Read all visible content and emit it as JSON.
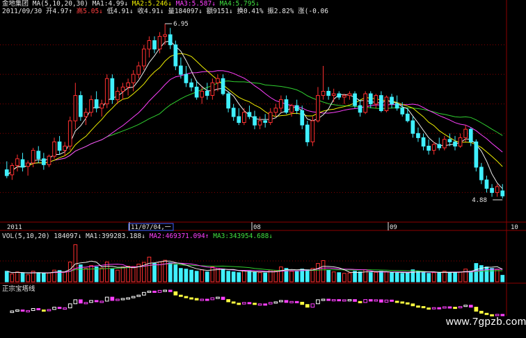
{
  "header": {
    "stock_name": "金地集团",
    "ma_label": "MA(5,10,20,30)",
    "ma1": "MA1:4.99↓",
    "ma2": "MA2:5.246↓",
    "ma3": "MA3:5.587↓",
    "ma4": "MA4:5.795↓",
    "date": "2011/09/30",
    "open": "开4.97↑",
    "high": "高5.05↓",
    "low": "低4.91↓",
    "close": "收4.91↓",
    "volume": "量184097↓",
    "amount": "额9151↓",
    "turnover": "换0.41%",
    "amplitude": "振2.82%",
    "change": "涨(-0.06"
  },
  "price_axis_labels": {
    "max_label": "6.95",
    "min_label": "4.88"
  },
  "x_axis": {
    "labels": [
      "2011",
      "11/07/04,一",
      "08",
      "09",
      "10"
    ]
  },
  "vol_header": {
    "label": "VOL(5,10,20)",
    "value": "184097↓",
    "ma1": "MA1:399283.188↓",
    "ma2": "MA2:469371.094↑",
    "ma3": "MA3:343954.688↓"
  },
  "indicator": {
    "label": "正宗宝塔线"
  },
  "watermark": "www.7gpzb.com",
  "colors": {
    "up": "#ff3030",
    "down": "#40f0ff",
    "ma5": "#f0f0f0",
    "ma10": "#f0f000",
    "ma20": "#ff40ff",
    "ma30": "#30d030",
    "grid": "#8b0000",
    "tower_up": "#ffffff",
    "tower_down": "#ffff40",
    "tower_switch": "#ff40ff"
  },
  "chart_data": {
    "type": "candlestick",
    "ylim": [
      4.6,
      7.05
    ],
    "candles": [
      [
        5.22,
        5.32,
        5.12,
        5.15
      ],
      [
        5.16,
        5.3,
        5.1,
        5.27
      ],
      [
        5.27,
        5.4,
        5.2,
        5.35
      ],
      [
        5.34,
        5.42,
        5.2,
        5.25
      ],
      [
        5.26,
        5.33,
        5.15,
        5.3
      ],
      [
        5.3,
        5.48,
        5.25,
        5.45
      ],
      [
        5.44,
        5.5,
        5.3,
        5.35
      ],
      [
        5.35,
        5.42,
        5.22,
        5.28
      ],
      [
        5.28,
        5.4,
        5.25,
        5.38
      ],
      [
        5.38,
        5.6,
        5.35,
        5.55
      ],
      [
        5.55,
        5.62,
        5.4,
        5.45
      ],
      [
        5.45,
        5.55,
        5.38,
        5.5
      ],
      [
        5.5,
        5.85,
        5.45,
        5.8
      ],
      [
        5.8,
        6.25,
        5.7,
        6.1
      ],
      [
        6.1,
        6.15,
        5.8,
        5.85
      ],
      [
        5.85,
        5.95,
        5.75,
        5.9
      ],
      [
        5.9,
        6.1,
        5.85,
        6.05
      ],
      [
        6.05,
        6.15,
        5.9,
        5.95
      ],
      [
        5.95,
        6.05,
        5.85,
        6.0
      ],
      [
        6.0,
        6.35,
        5.95,
        6.3
      ],
      [
        6.3,
        6.35,
        6.0,
        6.05
      ],
      [
        6.05,
        6.2,
        6.0,
        6.15
      ],
      [
        6.15,
        6.25,
        6.05,
        6.2
      ],
      [
        6.2,
        6.3,
        6.1,
        6.25
      ],
      [
        6.25,
        6.4,
        6.15,
        6.35
      ],
      [
        6.35,
        6.5,
        6.3,
        6.45
      ],
      [
        6.45,
        6.7,
        6.4,
        6.65
      ],
      [
        6.65,
        6.8,
        6.55,
        6.75
      ],
      [
        6.75,
        6.8,
        6.6,
        6.65
      ],
      [
        6.65,
        6.85,
        6.6,
        6.8
      ],
      [
        6.8,
        6.95,
        6.7,
        6.82
      ],
      [
        6.82,
        6.9,
        6.65,
        6.7
      ],
      [
        6.7,
        6.75,
        6.4,
        6.45
      ],
      [
        6.45,
        6.55,
        6.3,
        6.35
      ],
      [
        6.35,
        6.45,
        6.2,
        6.25
      ],
      [
        6.25,
        6.3,
        6.15,
        6.2
      ],
      [
        6.2,
        6.28,
        6.05,
        6.08
      ],
      [
        6.08,
        6.2,
        6.0,
        6.15
      ],
      [
        6.15,
        6.25,
        6.05,
        6.1
      ],
      [
        6.1,
        6.3,
        6.05,
        6.25
      ],
      [
        6.25,
        6.35,
        6.15,
        6.3
      ],
      [
        6.3,
        6.35,
        6.1,
        6.12
      ],
      [
        6.12,
        6.15,
        5.9,
        5.95
      ],
      [
        5.95,
        6.0,
        5.8,
        5.85
      ],
      [
        5.85,
        5.95,
        5.75,
        5.78
      ],
      [
        5.78,
        5.95,
        5.75,
        5.9
      ],
      [
        5.9,
        5.98,
        5.82,
        5.85
      ],
      [
        5.85,
        5.92,
        5.7,
        5.75
      ],
      [
        5.75,
        5.85,
        5.7,
        5.8
      ],
      [
        5.8,
        5.88,
        5.72,
        5.78
      ],
      [
        5.78,
        5.95,
        5.75,
        5.9
      ],
      [
        5.9,
        6.0,
        5.85,
        5.95
      ],
      [
        5.95,
        6.1,
        5.9,
        6.05
      ],
      [
        6.05,
        6.1,
        5.88,
        5.9
      ],
      [
        5.9,
        6.0,
        5.85,
        5.98
      ],
      [
        5.98,
        6.05,
        5.88,
        5.92
      ],
      [
        5.92,
        5.98,
        5.7,
        5.75
      ],
      [
        5.75,
        5.8,
        5.5,
        5.55
      ],
      [
        5.55,
        5.85,
        5.5,
        5.8
      ],
      [
        5.8,
        6.2,
        5.78,
        6.1
      ],
      [
        6.1,
        6.45,
        6.05,
        6.15
      ],
      [
        6.15,
        6.2,
        6.05,
        6.1
      ],
      [
        6.1,
        6.18,
        6.02,
        6.12
      ],
      [
        6.12,
        6.15,
        6.05,
        6.08
      ],
      [
        6.08,
        6.12,
        6.0,
        6.1
      ],
      [
        6.1,
        6.15,
        6.05,
        6.12
      ],
      [
        6.12,
        6.15,
        5.95,
        5.98
      ],
      [
        5.98,
        6.05,
        5.85,
        5.9
      ],
      [
        5.9,
        6.15,
        5.88,
        6.12
      ],
      [
        6.12,
        6.15,
        5.95,
        6.0
      ],
      [
        6.0,
        6.12,
        5.95,
        6.1
      ],
      [
        6.1,
        6.15,
        5.9,
        5.92
      ],
      [
        5.92,
        6.1,
        5.9,
        6.08
      ],
      [
        6.08,
        6.12,
        5.95,
        6.0
      ],
      [
        6.0,
        6.1,
        5.92,
        5.95
      ],
      [
        5.95,
        6.02,
        5.85,
        5.88
      ],
      [
        5.88,
        5.95,
        5.78,
        5.8
      ],
      [
        5.8,
        5.85,
        5.6,
        5.65
      ],
      [
        5.65,
        5.72,
        5.55,
        5.6
      ],
      [
        5.6,
        5.65,
        5.45,
        5.5
      ],
      [
        5.5,
        5.58,
        5.4,
        5.45
      ],
      [
        5.45,
        5.55,
        5.4,
        5.52
      ],
      [
        5.52,
        5.6,
        5.45,
        5.48
      ],
      [
        5.48,
        5.62,
        5.45,
        5.58
      ],
      [
        5.58,
        5.65,
        5.5,
        5.55
      ],
      [
        5.55,
        5.62,
        5.45,
        5.5
      ],
      [
        5.5,
        5.65,
        5.48,
        5.6
      ],
      [
        5.6,
        5.75,
        5.55,
        5.7
      ],
      [
        5.7,
        5.72,
        5.5,
        5.55
      ],
      [
        5.55,
        5.58,
        5.2,
        5.25
      ],
      [
        5.25,
        5.3,
        5.05,
        5.1
      ],
      [
        5.1,
        5.15,
        4.95,
        5.0
      ],
      [
        5.0,
        5.05,
        4.9,
        4.95
      ],
      [
        4.95,
        5.05,
        4.9,
        5.02
      ],
      [
        4.97,
        5.05,
        4.88,
        4.91
      ]
    ],
    "volume_ylim": [
      0,
      1200000
    ],
    "volumes": [
      300000,
      220000,
      280000,
      250000,
      200000,
      300000,
      260000,
      240000,
      250000,
      330000,
      320000,
      280000,
      560000,
      1050000,
      480000,
      380000,
      460000,
      420000,
      390000,
      560000,
      360000,
      330000,
      420000,
      440000,
      430000,
      500000,
      550000,
      700000,
      520000,
      560000,
      610000,
      540000,
      480000,
      380000,
      360000,
      330000,
      300000,
      340000,
      280000,
      420000,
      380000,
      360000,
      300000,
      280000,
      260000,
      320000,
      300000,
      270000,
      260000,
      250000,
      330000,
      310000,
      420000,
      380000,
      300000,
      290000,
      360000,
      340000,
      380000,
      520000,
      600000,
      330000,
      280000,
      260000,
      240000,
      250000,
      300000,
      280000,
      340000,
      260000,
      270000,
      300000,
      280000,
      260000,
      250000,
      240000,
      260000,
      340000,
      300000,
      280000,
      240000,
      260000,
      250000,
      300000,
      270000,
      260000,
      280000,
      360000,
      300000,
      520000,
      460000,
      420000,
      380000,
      350000,
      184097
    ]
  }
}
